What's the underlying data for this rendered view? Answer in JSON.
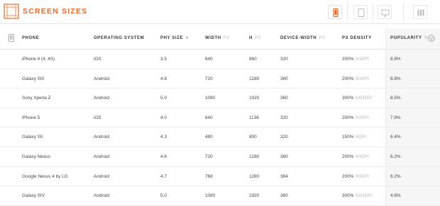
{
  "brand": {
    "title": "SCREEN SIZES",
    "accent_color": "#e56a2a"
  },
  "toolbar": {
    "buttons": [
      {
        "icon": "phone-icon",
        "active": true
      },
      {
        "icon": "tablet-icon",
        "active": false
      },
      {
        "icon": "monitor-icon",
        "active": false
      },
      {
        "icon": "columns-icon",
        "active": false
      }
    ]
  },
  "table": {
    "headers": {
      "phone": "PHONE",
      "os": "OPERATING SYSTEM",
      "phy_size": "PHY SIZE",
      "width": "WIDTH",
      "width_unit": "PX",
      "height": "H",
      "height_unit": "PX",
      "device_width": "DEVICE-WIDTH",
      "device_width_unit": "PX",
      "density": "PX DENSITY",
      "popularity": "POPULARITY",
      "popularity_unit": "%"
    },
    "rows": [
      {
        "phone": "iPhone 4 (4, 4S)",
        "os": "iOS",
        "size": "3.5",
        "width": "640",
        "height": "960",
        "device_width": "320",
        "density": "200%",
        "density_label": "XHDPI",
        "popularity": "8.8%"
      },
      {
        "phone": "Galaxy SIII",
        "os": "Android",
        "size": "4.8",
        "width": "720",
        "height": "1280",
        "device_width": "360",
        "density": "200%",
        "density_label": "XHDPI",
        "popularity": "8.8%"
      },
      {
        "phone": "Sony Xperia Z",
        "os": "Android",
        "size": "5.0",
        "width": "1080",
        "height": "1920",
        "device_width": "360",
        "density": "300%",
        "density_label": "XXHDPI",
        "popularity": "8.5%"
      },
      {
        "phone": "iPhone 5",
        "os": "iOS",
        "size": "4.0",
        "width": "640",
        "height": "1136",
        "device_width": "320",
        "density": "200%",
        "density_label": "XHDPI",
        "popularity": "7.9%"
      },
      {
        "phone": "Galaxy SII",
        "os": "Android",
        "size": "4.3",
        "width": "480",
        "height": "800",
        "device_width": "320",
        "density": "150%",
        "density_label": "HDPI",
        "popularity": "6.4%"
      },
      {
        "phone": "Galaxy Nexus",
        "os": "Android",
        "size": "4.6",
        "width": "720",
        "height": "1280",
        "device_width": "360",
        "density": "200%",
        "density_label": "XHDPI",
        "popularity": "6.2%"
      },
      {
        "phone": "Google Nexus 4 by LG",
        "os": "Android",
        "size": "4.7",
        "width": "768",
        "height": "1280",
        "device_width": "384",
        "density": "200%",
        "density_label": "XHDPI",
        "popularity": "6.2%"
      },
      {
        "phone": "Galaxy SIV",
        "os": "Android",
        "size": "5.0",
        "width": "1080",
        "height": "1920",
        "device_width": "360",
        "density": "300%",
        "density_label": "XXHDPI",
        "popularity": "4.6%"
      }
    ]
  }
}
